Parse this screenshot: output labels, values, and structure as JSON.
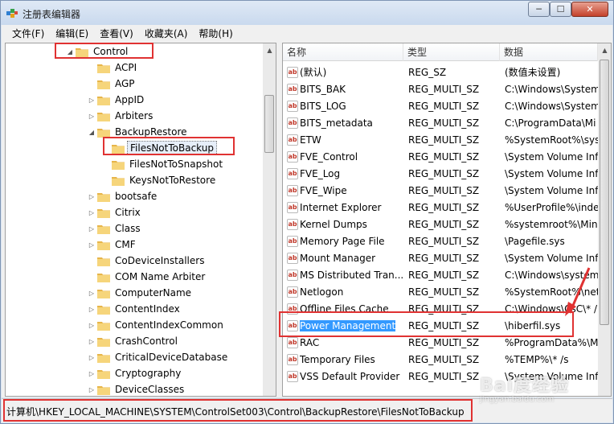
{
  "window": {
    "title": "注册表编辑器",
    "min_glyph": "─",
    "max_glyph": "☐",
    "close_glyph": "✕"
  },
  "menu": [
    {
      "label": "文件(F)"
    },
    {
      "label": "编辑(E)"
    },
    {
      "label": "查看(V)"
    },
    {
      "label": "收藏夹(A)"
    },
    {
      "label": "帮助(H)"
    }
  ],
  "tree": {
    "items": [
      {
        "label": "Control",
        "expanded": true,
        "level": 0,
        "highlighted": true
      },
      {
        "label": "ACPI",
        "level": 1,
        "expandable": false
      },
      {
        "label": "AGP",
        "level": 1,
        "expandable": false
      },
      {
        "label": "AppID",
        "level": 1,
        "expandable": true
      },
      {
        "label": "Arbiters",
        "level": 1,
        "expandable": true
      },
      {
        "label": "BackupRestore",
        "level": 1,
        "expanded": true
      },
      {
        "label": "FilesNotToBackup",
        "level": 2,
        "selected": true,
        "highlighted": true
      },
      {
        "label": "FilesNotToSnapshot",
        "level": 2
      },
      {
        "label": "KeysNotToRestore",
        "level": 2
      },
      {
        "label": "bootsafe",
        "level": 1,
        "expandable": true
      },
      {
        "label": "Citrix",
        "level": 1,
        "expandable": true
      },
      {
        "label": "Class",
        "level": 1,
        "expandable": true
      },
      {
        "label": "CMF",
        "level": 1,
        "expandable": true
      },
      {
        "label": "CoDeviceInstallers",
        "level": 1,
        "expandable": false
      },
      {
        "label": "COM Name Arbiter",
        "level": 1,
        "expandable": false
      },
      {
        "label": "ComputerName",
        "level": 1,
        "expandable": true
      },
      {
        "label": "ContentIndex",
        "level": 1,
        "expandable": true
      },
      {
        "label": "ContentIndexCommon",
        "level": 1,
        "expandable": true
      },
      {
        "label": "CrashControl",
        "level": 1,
        "expandable": true
      },
      {
        "label": "CriticalDeviceDatabase",
        "level": 1,
        "expandable": true
      },
      {
        "label": "Cryptography",
        "level": 1,
        "expandable": true
      },
      {
        "label": "DeviceClasses",
        "level": 1,
        "expandable": true
      }
    ]
  },
  "list": {
    "columns": [
      "名称",
      "类型",
      "数据"
    ],
    "rows": [
      {
        "name": "(默认)",
        "type": "REG_SZ",
        "data": "(数值未设置)"
      },
      {
        "name": "BITS_BAK",
        "type": "REG_MULTI_SZ",
        "data": "C:\\Windows\\System"
      },
      {
        "name": "BITS_LOG",
        "type": "REG_MULTI_SZ",
        "data": "C:\\Windows\\System"
      },
      {
        "name": "BITS_metadata",
        "type": "REG_MULTI_SZ",
        "data": "C:\\ProgramData\\Mi"
      },
      {
        "name": "ETW",
        "type": "REG_MULTI_SZ",
        "data": "%SystemRoot%\\sys"
      },
      {
        "name": "FVE_Control",
        "type": "REG_MULTI_SZ",
        "data": "\\System Volume Inf"
      },
      {
        "name": "FVE_Log",
        "type": "REG_MULTI_SZ",
        "data": "\\System Volume Inf"
      },
      {
        "name": "FVE_Wipe",
        "type": "REG_MULTI_SZ",
        "data": "\\System Volume Inf"
      },
      {
        "name": "Internet Explorer",
        "type": "REG_MULTI_SZ",
        "data": "%UserProfile%\\inde"
      },
      {
        "name": "Kernel Dumps",
        "type": "REG_MULTI_SZ",
        "data": "%systemroot%\\Min"
      },
      {
        "name": "Memory Page File",
        "type": "REG_MULTI_SZ",
        "data": "\\Pagefile.sys"
      },
      {
        "name": "Mount Manager",
        "type": "REG_MULTI_SZ",
        "data": "\\System Volume Inf"
      },
      {
        "name": "MS Distributed Tran...",
        "type": "REG_MULTI_SZ",
        "data": "C:\\Windows\\system"
      },
      {
        "name": "Netlogon",
        "type": "REG_MULTI_SZ",
        "data": "%SystemRoot%\\net"
      },
      {
        "name": "Offline Files Cache",
        "type": "REG_MULTI_SZ",
        "data": "C:\\Windows\\CsC\\* /"
      },
      {
        "name": "Power Management",
        "type": "REG_MULTI_SZ",
        "data": "\\hiberfil.sys",
        "selected": true
      },
      {
        "name": "RAC",
        "type": "REG_MULTI_SZ",
        "data": "%ProgramData%\\M"
      },
      {
        "name": "Temporary Files",
        "type": "REG_MULTI_SZ",
        "data": "%TEMP%\\* /s"
      },
      {
        "name": "VSS Default Provider",
        "type": "REG_MULTI_SZ",
        "data": "\\System Volume Inf"
      }
    ]
  },
  "status": {
    "path": "计算机\\HKEY_LOCAL_MACHINE\\SYSTEM\\ControlSet003\\Control\\BackupRestore\\FilesNotToBackup"
  },
  "watermark": {
    "main": "Bai度经验",
    "sub": "jingyan.baidu.com"
  },
  "colors": {
    "highlight_red": "#e03232",
    "selection_blue": "#3399ff",
    "folder_yellow": "#f2c55c"
  }
}
